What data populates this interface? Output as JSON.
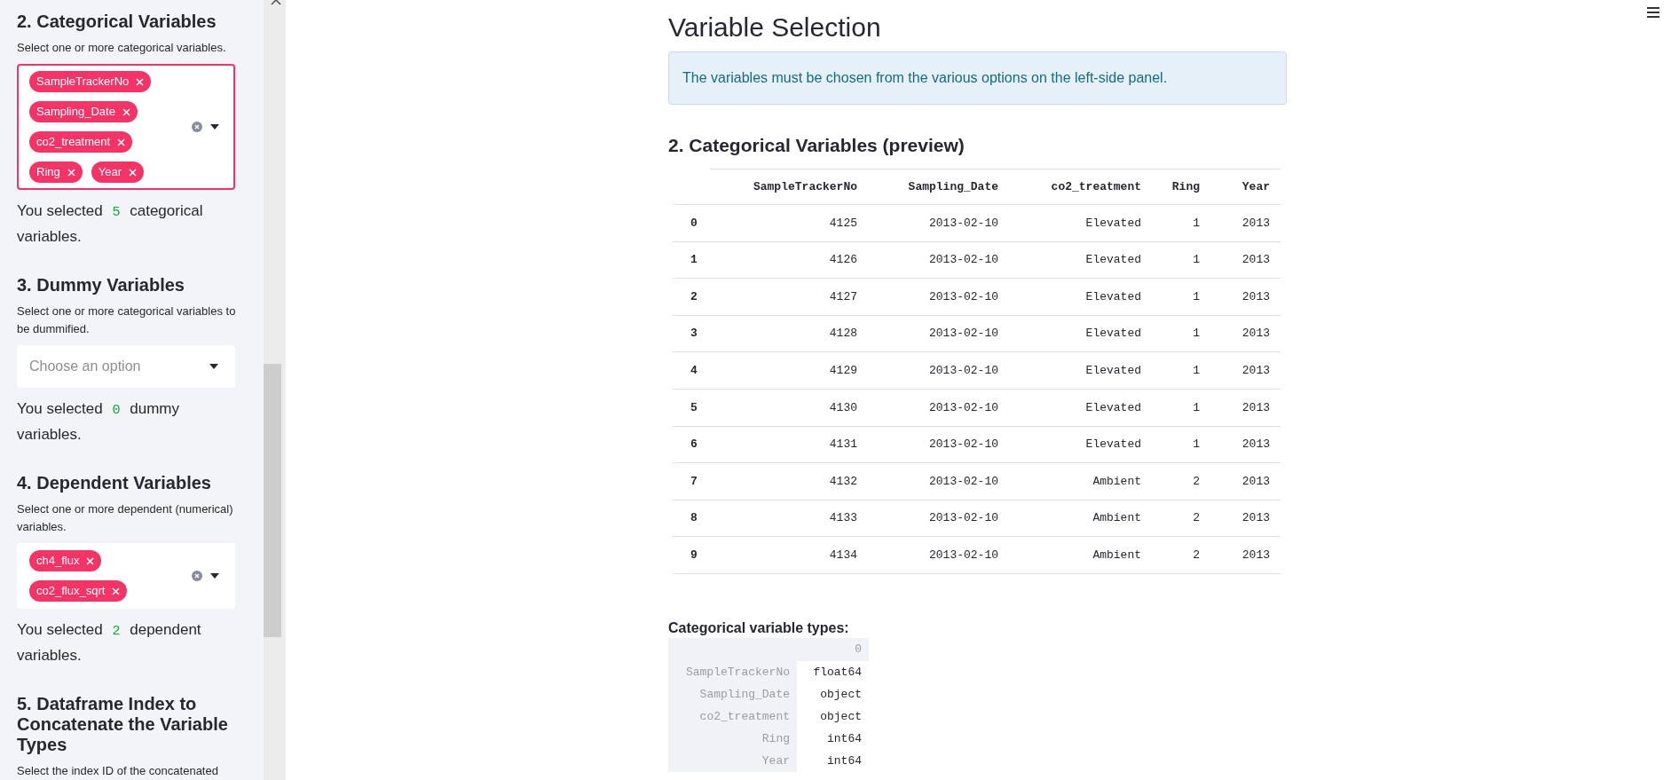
{
  "sidebar": {
    "sections": [
      {
        "kind": "multiselect",
        "heading": "2. Categorical Variables",
        "help": "Select one or more categorical variables.",
        "focused": true,
        "chips": [
          "SampleTrackerNo",
          "Sampling_Date",
          "co2_treatment",
          "Ring",
          "Year"
        ],
        "result": {
          "prefix": "You selected",
          "count": "5",
          "suffix": "categorical variables."
        }
      },
      {
        "kind": "select",
        "heading": "3. Dummy Variables",
        "help": "Select one or more categorical variables to be dummified.",
        "placeholder": "Choose an option",
        "result": {
          "prefix": "You selected",
          "count": "0",
          "suffix": "dummy variables."
        }
      },
      {
        "kind": "multiselect",
        "heading": "4. Dependent Variables",
        "help": "Select one or more dependent (numerical) variables.",
        "focused": false,
        "chips": [
          "ch4_flux",
          "co2_flux_sqrt"
        ],
        "result": {
          "prefix": "You selected",
          "count": "2",
          "suffix": "dependent variables."
        }
      },
      {
        "kind": "text",
        "heading": "5. Dataframe Index to Concatenate the Variable Types",
        "help": "Select the index ID of the concatenated"
      }
    ]
  },
  "main": {
    "title": "Variable Selection",
    "info": "The variables must be chosen from the various options on the left-side panel.",
    "preview_heading": "2. Categorical Variables (preview)",
    "table": {
      "columns": [
        "SampleTrackerNo",
        "Sampling_Date",
        "co2_treatment",
        "Ring",
        "Year"
      ],
      "rows": [
        {
          "index": "0",
          "cells": [
            "4125",
            "2013-02-10",
            "Elevated",
            "1",
            "2013"
          ]
        },
        {
          "index": "1",
          "cells": [
            "4126",
            "2013-02-10",
            "Elevated",
            "1",
            "2013"
          ]
        },
        {
          "index": "2",
          "cells": [
            "4127",
            "2013-02-10",
            "Elevated",
            "1",
            "2013"
          ]
        },
        {
          "index": "3",
          "cells": [
            "4128",
            "2013-02-10",
            "Elevated",
            "1",
            "2013"
          ]
        },
        {
          "index": "4",
          "cells": [
            "4129",
            "2013-02-10",
            "Elevated",
            "1",
            "2013"
          ]
        },
        {
          "index": "5",
          "cells": [
            "4130",
            "2013-02-10",
            "Elevated",
            "1",
            "2013"
          ]
        },
        {
          "index": "6",
          "cells": [
            "4131",
            "2013-02-10",
            "Elevated",
            "1",
            "2013"
          ]
        },
        {
          "index": "7",
          "cells": [
            "4132",
            "2013-02-10",
            "Ambient",
            "2",
            "2013"
          ]
        },
        {
          "index": "8",
          "cells": [
            "4133",
            "2013-02-10",
            "Ambient",
            "2",
            "2013"
          ]
        },
        {
          "index": "9",
          "cells": [
            "4134",
            "2013-02-10",
            "Ambient",
            "2",
            "2013"
          ]
        }
      ]
    },
    "types_label": "Categorical variable types:",
    "types_table": {
      "column": "0",
      "rows": [
        {
          "name": "SampleTrackerNo",
          "dtype": "float64"
        },
        {
          "name": "Sampling_Date",
          "dtype": "object"
        },
        {
          "name": "co2_treatment",
          "dtype": "object"
        },
        {
          "name": "Ring",
          "dtype": "int64"
        },
        {
          "name": "Year",
          "dtype": "int64"
        }
      ]
    }
  }
}
